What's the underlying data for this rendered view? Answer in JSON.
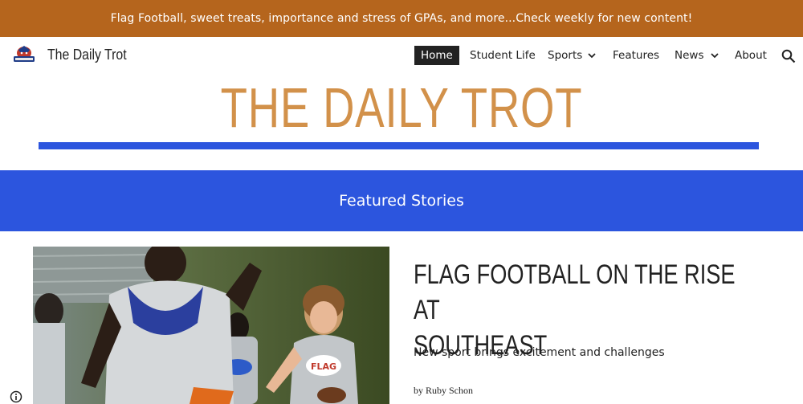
{
  "announcement": {
    "text": "Flag Football, sweet treats, importance and stress of GPAs, and more...Check weekly for new content!"
  },
  "header": {
    "site_name": "The Daily Trot",
    "logo_icon": "school-mascot-logo-icon",
    "nav": [
      {
        "label": "Home",
        "active": true
      },
      {
        "label": "Student Life",
        "active": false
      },
      {
        "label": "Sports",
        "active": false,
        "has_dropdown": true
      },
      {
        "label": "Features",
        "active": false
      },
      {
        "label": "News",
        "active": false,
        "has_dropdown": true
      },
      {
        "label": "About",
        "active": false
      }
    ],
    "search_icon": "search-icon"
  },
  "hero": {
    "title": "THE DAILY TROT"
  },
  "featured": {
    "heading": "Featured Stories"
  },
  "story": {
    "headline_line1": "FLAG FOOTBALL ON THE RISE AT",
    "headline_line2": "SOUTHEAST",
    "subtitle": "New sport brings excitement and challenges",
    "byline": "by Ruby Schon",
    "photo_jersey_text": "FLAG"
  },
  "colors": {
    "announcement_bg": "#b5651d",
    "hero_title": "#d2914a",
    "accent_blue": "#2c55de",
    "nav_active_bg": "#222222"
  }
}
